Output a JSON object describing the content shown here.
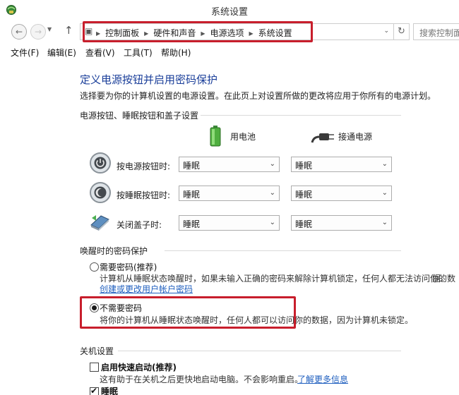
{
  "window": {
    "title": "系统设置"
  },
  "nav": {
    "breadcrumbs": [
      "控制面板",
      "硬件和声音",
      "电源选项",
      "系统设置"
    ],
    "search_placeholder": "搜索控制面板"
  },
  "menu": {
    "items": [
      "文件(F)",
      "编辑(E)",
      "查看(V)",
      "工具(T)",
      "帮助(H)"
    ]
  },
  "page": {
    "heading": "定义电源按钮并启用密码保护",
    "description": "选择要为你的计算机设置的电源设置。在此页上对设置所做的更改将应用于你所有的电源计划。"
  },
  "power_buttons": {
    "group_title": "电源按钮、睡眠按钮和盖子设置",
    "columns": {
      "battery": "用电池",
      "plugged_in": "接通电源"
    },
    "rows": [
      {
        "label": "按电源按钮时:",
        "battery": "睡眠",
        "plugged_in": "睡眠"
      },
      {
        "label": "按睡眠按钮时:",
        "battery": "睡眠",
        "plugged_in": "睡眠"
      },
      {
        "label": "关闭盖子时:",
        "battery": "睡眠",
        "plugged_in": "睡眠"
      }
    ]
  },
  "password": {
    "group_title": "唤醒时的密码保护",
    "require": {
      "label": "需要密码(推荐)",
      "desc": "计算机从睡眠状态唤醒时，如果未输入正确的密码来解除计算机锁定，任何人都无法访问你的数",
      "desc2": "据。",
      "link": "创建或更改用户帐户密码",
      "checked": false
    },
    "no_require": {
      "label": "不需要密码",
      "desc": "将你的计算机从睡眠状态唤醒时，任何人都可以访问你的数据，因为计算机未锁定。",
      "checked": true
    }
  },
  "shutdown": {
    "group_title": "关机设置",
    "fast_startup": {
      "label": "启用快速启动(推荐)",
      "desc": "这有助于在关机之后更快地启动电脑。不会影响重启。",
      "link": "了解更多信息",
      "checked": false
    },
    "sleep": {
      "label": "睡眠",
      "checked": true
    }
  },
  "colors": {
    "heading": "#1b3f9a",
    "link": "#1f5fbf",
    "highlight": "#c81e2c"
  }
}
